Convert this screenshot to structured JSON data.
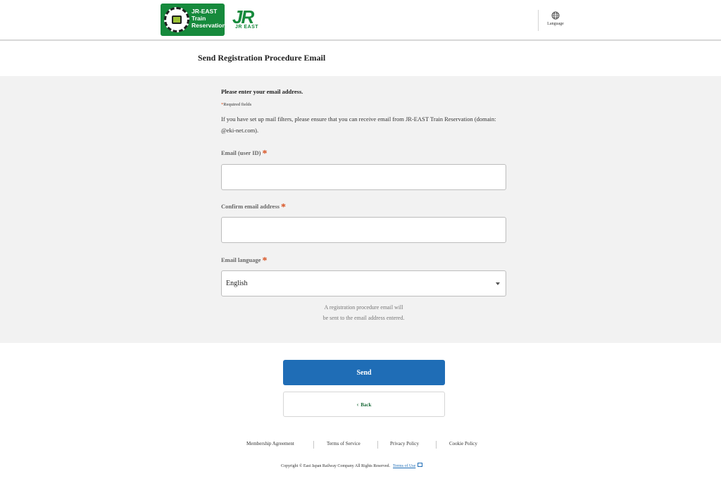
{
  "header": {
    "logo_text_line1": "JR-EAST",
    "logo_text_line2": "Train",
    "logo_text_line3": "Reservation",
    "jr_mark": "JR",
    "jr_sub": "JR EAST",
    "language_label": "Language"
  },
  "page": {
    "title": "Send Registration Procedure Email"
  },
  "form": {
    "intro": "Please enter your email address.",
    "required_star": "*",
    "required_note": "Required fields",
    "filter_note": "If you have set up mail filters, please ensure that you can receive email from JR-EAST Train Reservation (domain: @eki-net.com).",
    "email_label": "Email (user ID)",
    "email_value": "",
    "confirm_label": "Confirm email address",
    "confirm_value": "",
    "language_label": "Email language",
    "language_selected": "English",
    "info_line1": "A registration procedure email will",
    "info_line2": "be sent to the email address entered."
  },
  "actions": {
    "send_label": "Send",
    "back_label": "Back"
  },
  "footer": {
    "links": [
      "Membership Agreement",
      "Terms of Service",
      "Privacy Policy",
      "Cookie Policy"
    ],
    "copyright": "Copyright © East Japan Railway Company All Rights Reserved.",
    "terms_of_use": "Terms of Use"
  },
  "colors": {
    "brand_green": "#168a3c",
    "primary_blue": "#1f6db6",
    "required_orange": "#d8501e",
    "form_background": "#f2f2f2"
  },
  "icons": {
    "language": "globe-icon",
    "select": "caret-down-icon",
    "back": "chevron-left-icon",
    "external": "external-link-icon"
  }
}
